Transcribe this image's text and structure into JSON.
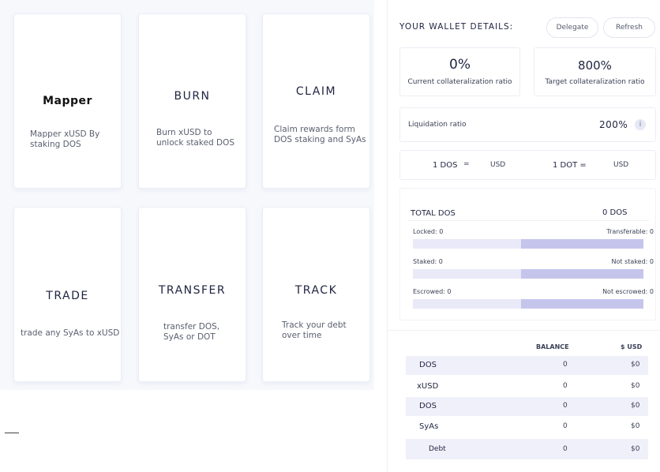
{
  "cards": [
    {
      "title": "Mapper",
      "desc_line1": "Mapper xUSD By",
      "desc_line2": "staking DOS"
    },
    {
      "title": "BURN",
      "desc_line1": "Burn xUSD to",
      "desc_line2": "unlock staked DOS"
    },
    {
      "title": "CLAIM",
      "desc_line1": "Claim rewards form",
      "desc_line2": "DOS staking and SyAs"
    },
    {
      "title": "TRADE",
      "desc_line1": "trade any SyAs to xUSD",
      "desc_line2": ""
    },
    {
      "title": "TRANSFER",
      "desc_line1": "transfer DOS,",
      "desc_line2": "SyAs or DOT"
    },
    {
      "title": "TRACK",
      "desc_line1": "Track your debt",
      "desc_line2": "over time"
    }
  ],
  "wallet": {
    "title": "YOUR WALLET DETAILS:",
    "delegate_label": "Delegate",
    "refresh_label": "Refresh",
    "current_ratio_value": "0%",
    "current_ratio_label": "Current collateralization ratio",
    "target_ratio_value": "800%",
    "target_ratio_label": "Target collateralization ratio",
    "liquidation_label": "Liquidation ratio",
    "liquidation_value": "200%",
    "info_glyph": "i",
    "rate_dos_label": "1 DOS",
    "rate_dos_eq": "=",
    "rate_dos_unit": "USD",
    "rate_dot_label": "1 DOT =",
    "rate_dot_unit": "USD",
    "total_dos_label": "TOTAL DOS",
    "total_dos_value": "0 DOS",
    "locked_label": "Locked: 0",
    "transferable_label": "Transferable: 0",
    "staked_label": "Staked: 0",
    "not_staked_label": "Not staked: 0",
    "escrowed_label": "Escrowed: 0",
    "not_escrowed_label": "Not escrowed: 0",
    "bar_fill_fraction": 0.53
  },
  "balances": {
    "col_balance": "BALANCE",
    "col_usd": "$ USD",
    "rows": [
      {
        "asset": "DOS",
        "balance": "0",
        "usd": "$0"
      },
      {
        "asset": "xUSD",
        "balance": "0",
        "usd": "$0"
      },
      {
        "asset": "DOS",
        "balance": "0",
        "usd": "$0"
      },
      {
        "asset": "SyAs",
        "balance": "0",
        "usd": "$0"
      },
      {
        "asset": "Debt",
        "balance": "0",
        "usd": "$0"
      }
    ]
  }
}
